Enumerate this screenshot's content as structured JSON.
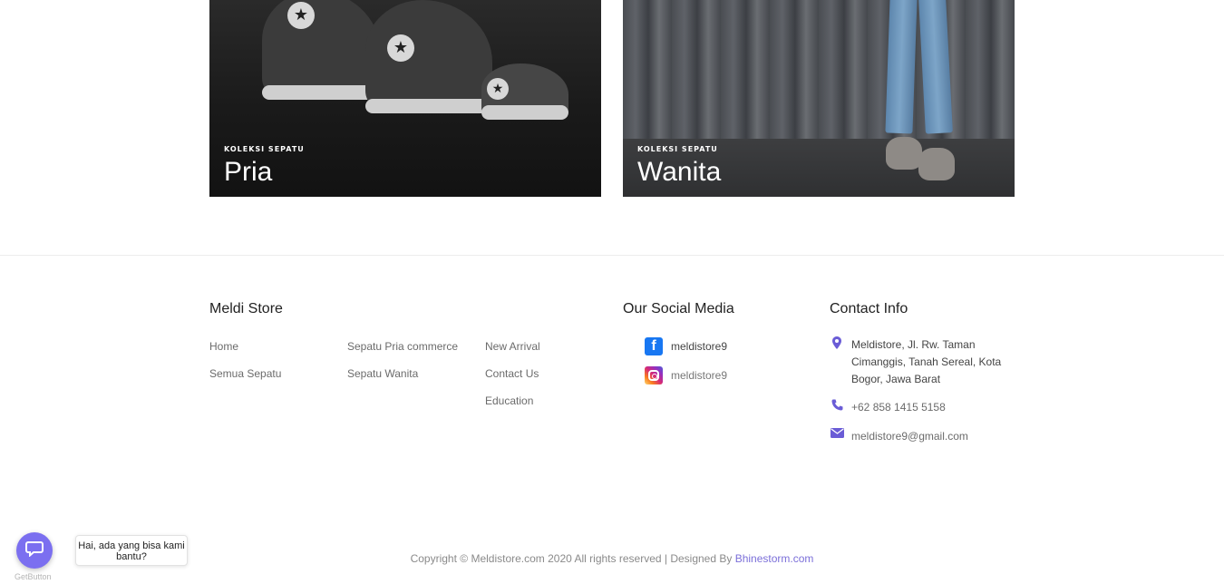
{
  "collections": [
    {
      "kicker": "KOLEKSI SEPATU",
      "title": "Pria"
    },
    {
      "kicker": "KOLEKSI SEPATU",
      "title": "Wanita"
    }
  ],
  "footer": {
    "store_heading": "Meldi Store",
    "links_col1": [
      "Home",
      "Semua Sepatu"
    ],
    "links_col2": [
      "Sepatu Pria commerce",
      "Sepatu Wanita"
    ],
    "links_col3": [
      "New Arrival",
      "Contact Us",
      "Education"
    ],
    "social_heading": "Our Social Media",
    "social": [
      {
        "icon": "facebook-icon",
        "label": "meldistore9"
      },
      {
        "icon": "instagram-icon",
        "label": "meldistore9"
      }
    ],
    "contact_heading": "Contact Info",
    "contact": {
      "address": "Meldistore, Jl. Rw. Taman Cimanggis, Tanah Sereal, Kota Bogor, Jawa Barat",
      "phone": "+62 858 1415 5158",
      "email": "meldistore9@gmail.com"
    },
    "copyright_text": "Copyright © Meldistore.com 2020 All rights reserved | Designed By ",
    "designer_link": "Bhinestorm.com"
  },
  "chat_widget": {
    "tooltip": "Hai, ada yang bisa kami bantu?",
    "brand": "GetButton",
    "accent": "#7b6ff0"
  },
  "colors": {
    "accent": "#6a5cd6",
    "link_accent": "#7b6fd9"
  }
}
